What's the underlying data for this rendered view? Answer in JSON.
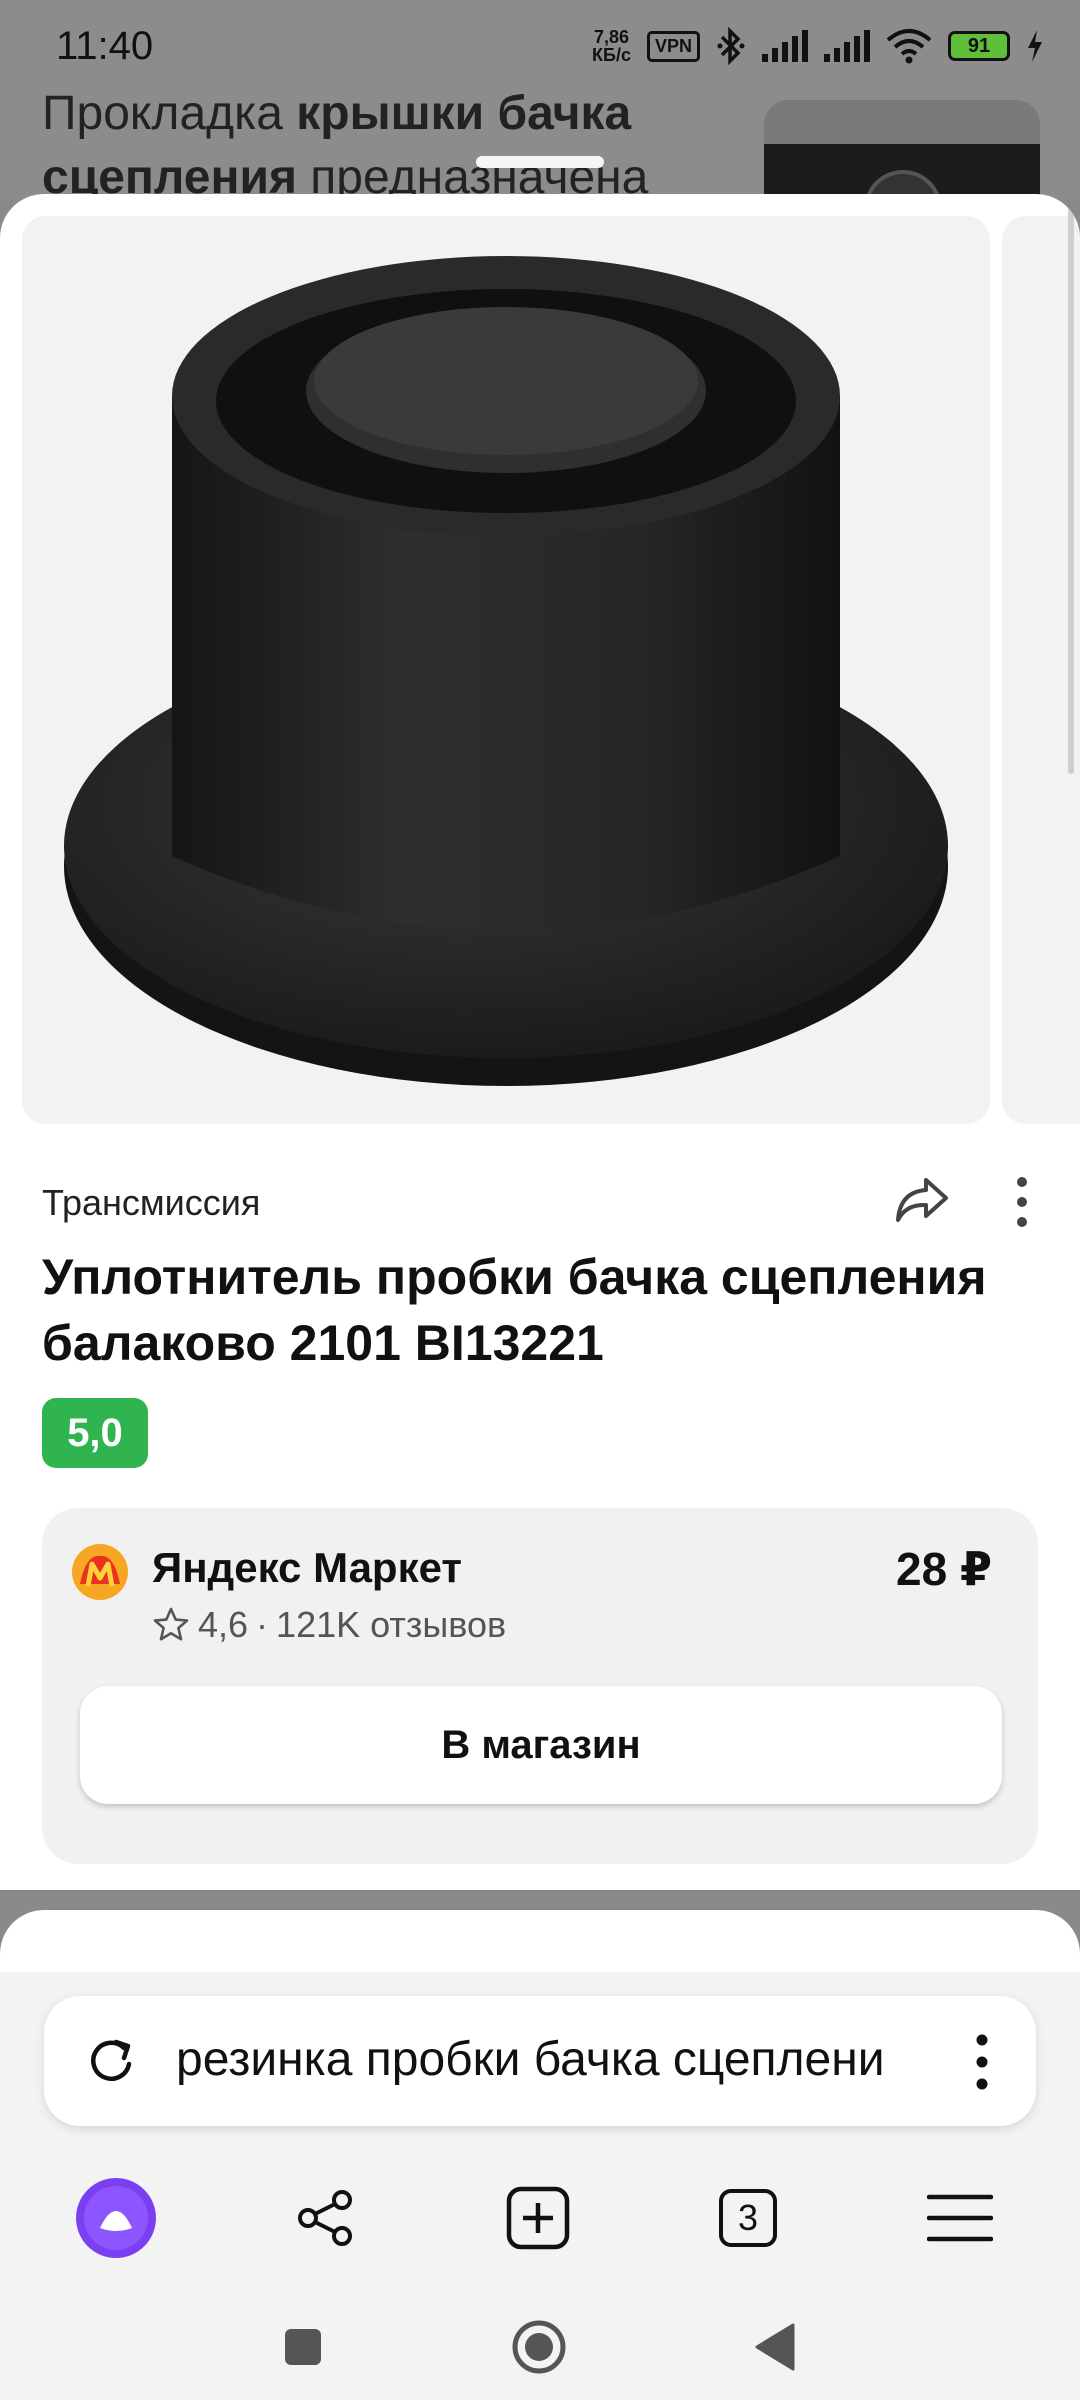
{
  "status_bar": {
    "time": "11:40",
    "net_speed_value": "7,86",
    "net_speed_unit": "КБ/с",
    "vpn": "VPN",
    "battery": "91"
  },
  "background_page": {
    "text_normal_1": "Прокладка ",
    "text_bold_1": "крышки бачка сцепления",
    "text_normal_2": " предназначена"
  },
  "product": {
    "category": "Трансмиссия",
    "title": "Уплотнитель пробки бачка сцепления балаково 2101 BI13221",
    "rating": "5,0"
  },
  "shop": {
    "name": "Яндекс Маркет",
    "price": "28 ₽",
    "rating": "4,6",
    "reviews": "121K отзывов",
    "button_label": "В магазин"
  },
  "browser": {
    "query": "резинка пробки бачка сцеплени",
    "tabs_count": "3"
  },
  "colors": {
    "rating_green": "#2fb450",
    "alice_purple": "#7b3ff2"
  }
}
